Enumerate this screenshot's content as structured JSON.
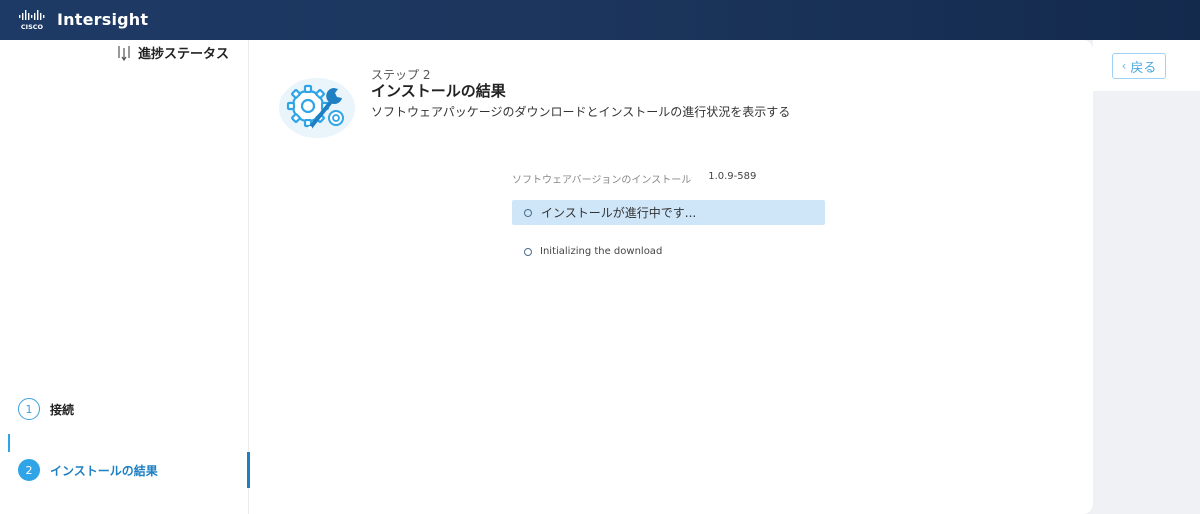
{
  "app": {
    "title": "Intersight",
    "logo_icon": "cisco-logo",
    "header_bg": "#1c355c",
    "accent": "#2fa4e7"
  },
  "back_button": {
    "label": "戻る"
  },
  "sidebar": {
    "title": "進捗ステータス",
    "steps": [
      {
        "number": "1",
        "label": "接続",
        "state": "completed"
      },
      {
        "number": "2",
        "label": "インストールの結果",
        "state": "active"
      }
    ]
  },
  "main": {
    "step_label": "ステップ 2",
    "title": "インストールの結果",
    "subtitle": "ソフトウェアパッケージのダウンロードとインストールの進行状況を表示する",
    "version_label": "ソフトウェアバージョンのインストール",
    "version_value": "1.0.9-589",
    "status_text": "インストールが進行中です...",
    "sub_status_text": "Initializing the download"
  }
}
